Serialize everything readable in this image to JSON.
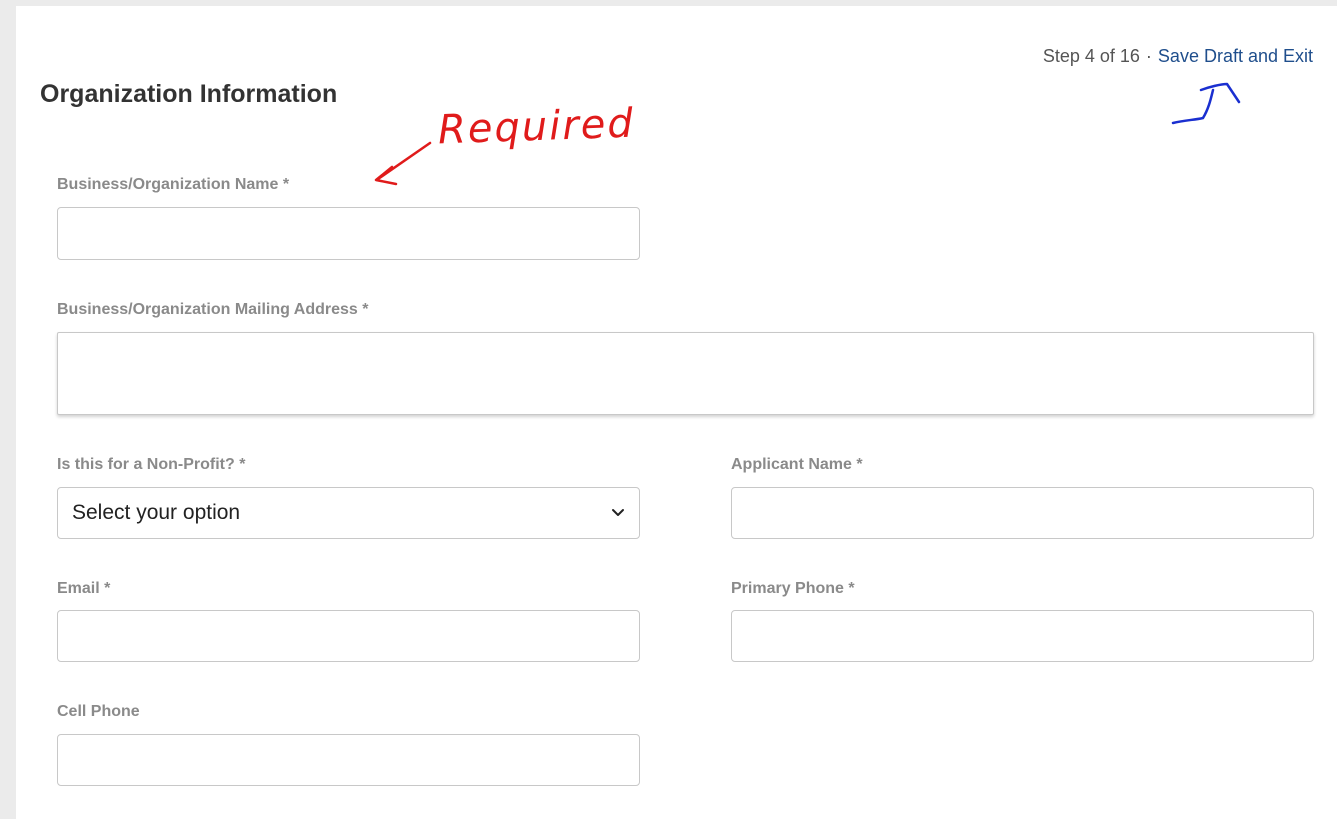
{
  "header": {
    "title": "Organization Information",
    "step": "Step 4 of 16",
    "separator": "·",
    "save_exit_label": "Save Draft and Exit"
  },
  "annotation": {
    "handwritten_note": "Required",
    "note_color": "#e01b1b",
    "arrow_color": "#1a2fd0"
  },
  "form": {
    "org_name_label": "Business/Organization Name *",
    "org_name_value": "",
    "mailing_address_label": "Business/Organization Mailing Address *",
    "mailing_address_value": "",
    "non_profit_label": "Is this for a Non-Profit? *",
    "non_profit_selected": "Select your option",
    "applicant_name_label": "Applicant Name *",
    "applicant_name_value": "",
    "email_label": "Email *",
    "email_value": "",
    "primary_phone_label": "Primary Phone *",
    "primary_phone_value": "",
    "cell_phone_label": "Cell Phone",
    "cell_phone_value": ""
  },
  "icons": {
    "select_chevron": "chevron-down-icon"
  },
  "colors": {
    "link": "#1f4e8c",
    "label": "#8a8a8a",
    "title": "#333333",
    "page_bg": "#ebebeb"
  }
}
